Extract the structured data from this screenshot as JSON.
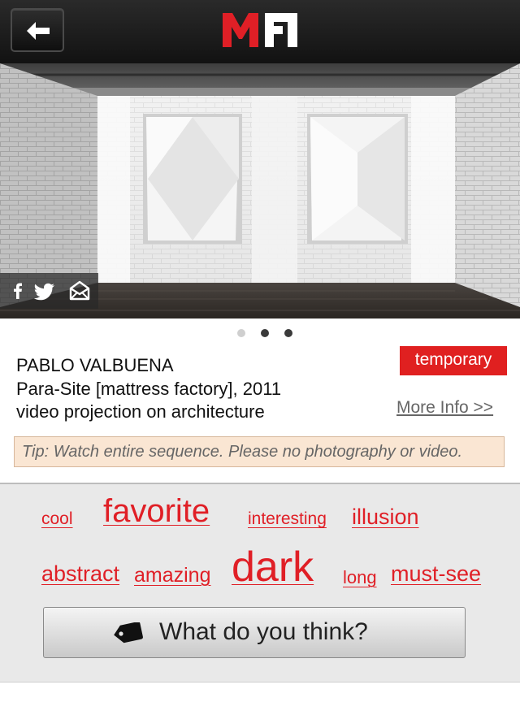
{
  "header": {
    "back_icon": "arrow-left-icon",
    "logo_text": "MF"
  },
  "share": {
    "icons": [
      "facebook-icon",
      "twitter-icon",
      "email-icon"
    ]
  },
  "pager": {
    "count": 3,
    "active_index": 0
  },
  "artwork": {
    "artist": "PABLO VALBUENA",
    "title_line": "Para-Site [mattress factory], 2011",
    "medium": "video projection on architecture",
    "badge": "temporary",
    "more_info": "More Info >>"
  },
  "tip": "Tip: Watch entire sequence. Please no photography or video.",
  "tags": [
    {
      "label": "cool"
    },
    {
      "label": "favorite"
    },
    {
      "label": "interesting"
    },
    {
      "label": "illusion"
    },
    {
      "label": "abstract"
    },
    {
      "label": "amazing"
    },
    {
      "label": "dark"
    },
    {
      "label": "long"
    },
    {
      "label": "must-see"
    }
  ],
  "feedback_button": {
    "label": "What do you think?",
    "icon": "tag-icon"
  },
  "colors": {
    "accent": "#e01f26",
    "badge_bg": "#e02020",
    "tip_bg": "#fae6d3",
    "header_bg": "#1a1a1a"
  }
}
